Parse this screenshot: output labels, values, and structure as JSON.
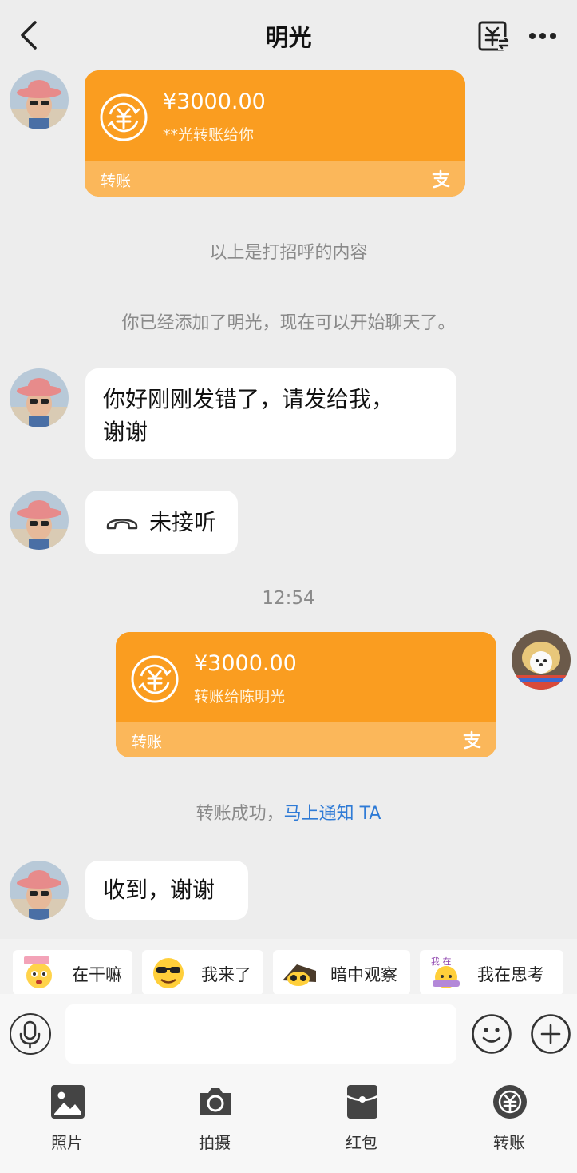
{
  "header": {
    "title": "明光"
  },
  "messages": {
    "transfer1": {
      "amount": "¥3000.00",
      "desc": "**光转账给你",
      "type": "转账"
    },
    "sys_greeting": "以上是打招呼的内容",
    "sys_added": "你已经添加了明光，现在可以开始聊天了。",
    "text1": {
      "line1": "你好刚刚发错了，请发给我，",
      "line2": "谢谢"
    },
    "missed_call": "未接听",
    "time": "12:54",
    "transfer2": {
      "amount": "¥3000.00",
      "desc": "转账给陈明光",
      "type": "转账"
    },
    "transfer_status": {
      "text": "转账成功，",
      "link": "马上通知 TA"
    },
    "text2": "收到，谢谢"
  },
  "stickers": [
    {
      "label": "在干嘛",
      "icon": "sticker-zaiganma"
    },
    {
      "label": "我来了",
      "icon": "sticker-cool-face"
    },
    {
      "label": "暗中观察",
      "icon": "sticker-peek"
    },
    {
      "label": "我在思考",
      "icon": "sticker-thinking"
    }
  ],
  "input": {
    "placeholder": ""
  },
  "tools": [
    {
      "label": "照片",
      "icon": "photo-icon"
    },
    {
      "label": "拍摄",
      "icon": "camera-icon"
    },
    {
      "label": "红包",
      "icon": "red-packet-icon"
    },
    {
      "label": "转账",
      "icon": "transfer-icon"
    }
  ],
  "colors": {
    "background": "#ededed",
    "transfer_orange": "#fa9d20",
    "transfer_orange_light": "#fbb75a",
    "link_blue": "#2f7bd6"
  }
}
